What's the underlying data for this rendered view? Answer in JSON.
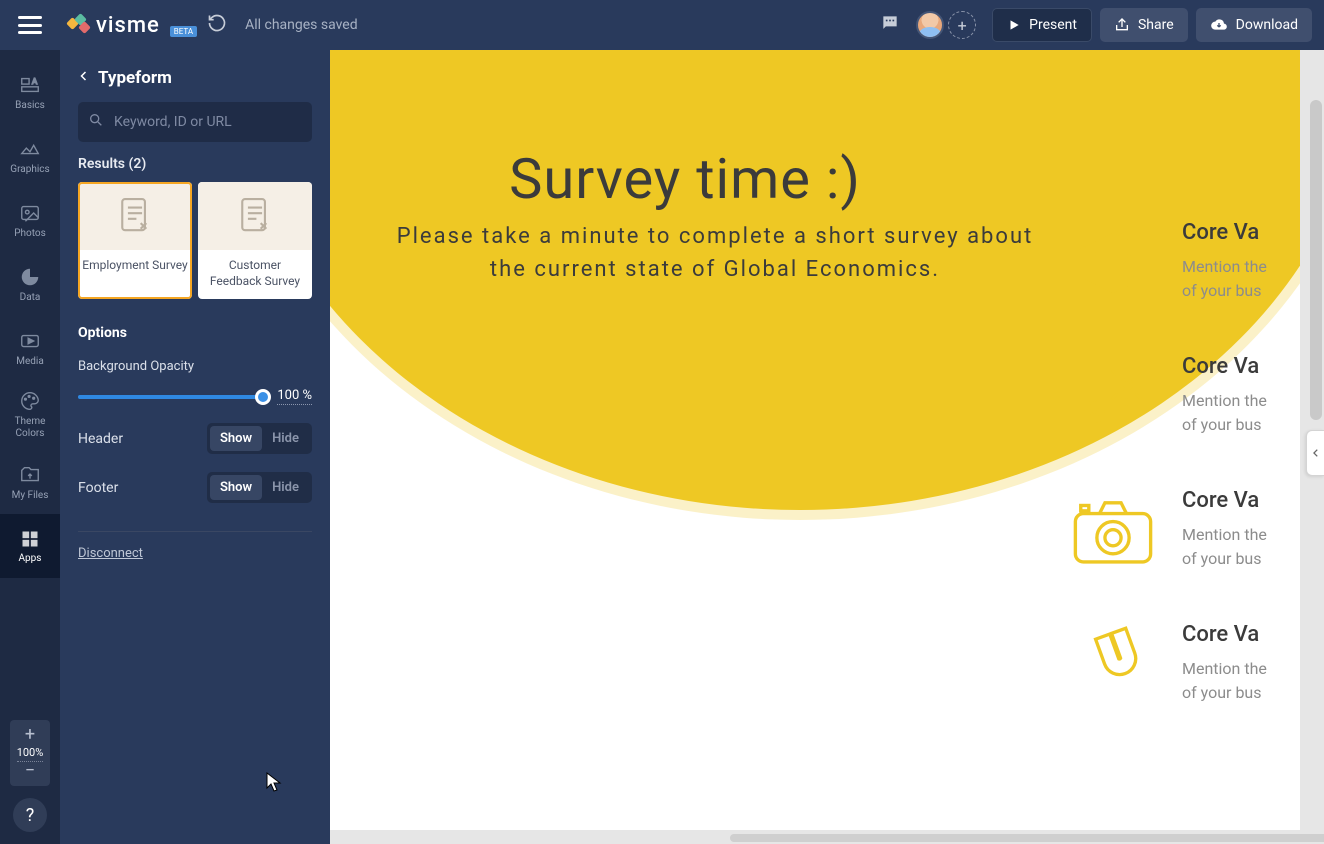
{
  "topbar": {
    "brand": "visme",
    "beta": "BETA",
    "saved": "All changes saved",
    "present": "Present",
    "share": "Share",
    "download": "Download"
  },
  "rail": {
    "basics": "Basics",
    "graphics": "Graphics",
    "photos": "Photos",
    "data": "Data",
    "media": "Media",
    "theme": "Theme Colors",
    "files": "My Files",
    "apps": "Apps",
    "zoom": "100%"
  },
  "panel": {
    "title": "Typeform",
    "search_placeholder": "Keyword, ID or URL",
    "results_label": "Results (2)",
    "cards": [
      {
        "title": "Employment Survey"
      },
      {
        "title": "Customer Feedback Survey"
      }
    ],
    "options_title": "Options",
    "bg_opacity_label": "Background Opacity",
    "bg_opacity_value": "100 %",
    "header_label": "Header",
    "footer_label": "Footer",
    "show": "Show",
    "hide": "Hide",
    "disconnect": "Disconnect"
  },
  "canvas": {
    "title": "Survey time :)",
    "subtitle": "Please take a minute to complete a short survey about the current state of Global Economics.",
    "core_heading": "Core Va",
    "core_line1": "Mention the",
    "core_line2": "of your bus"
  }
}
